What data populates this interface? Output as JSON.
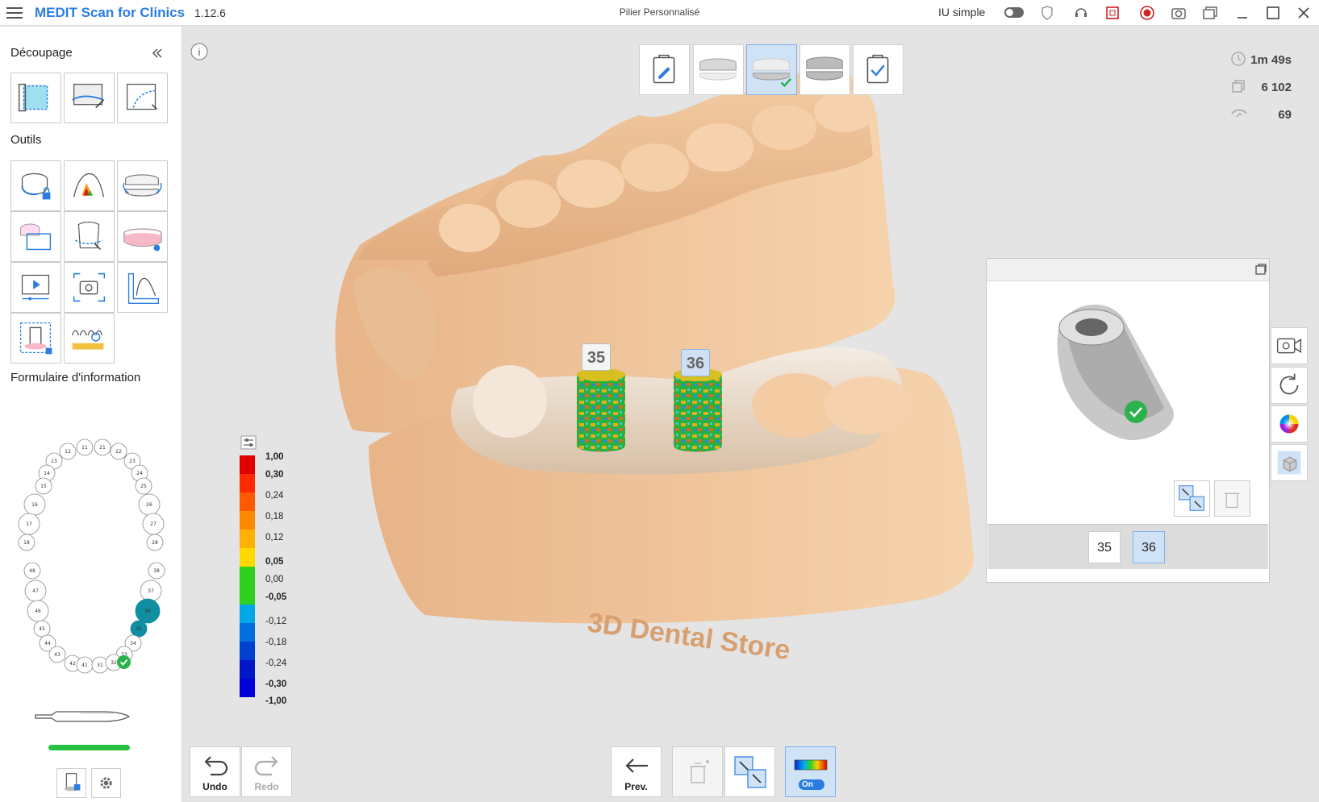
{
  "titlebar": {
    "app_name": "MEDIT Scan for Clinics",
    "version": "1.12.6",
    "document_title": "Pilier Personnalisé",
    "simple_ui_label": "IU simple",
    "icons": [
      "menu-icon",
      "shield-icon",
      "support-headset-icon",
      "screen-record-region-icon",
      "record-icon",
      "camera-icon",
      "window-switch-icon",
      "minimize-icon",
      "maximize-icon",
      "close-icon"
    ]
  },
  "sidebar": {
    "cutting_title": "Découpage",
    "tools_title": "Outils",
    "info_form_title": "Formulaire d'information",
    "collapse_icon": "double-chevron-left-icon",
    "teeth_upper": [
      "11",
      "21",
      "12",
      "22",
      "13",
      "23",
      "14",
      "24",
      "15",
      "25",
      "16",
      "26",
      "17",
      "27",
      "18",
      "28"
    ],
    "teeth_lower": [
      "48",
      "38",
      "47",
      "37",
      "46",
      "36",
      "45",
      "35",
      "44",
      "34",
      "43",
      "33",
      "42",
      "41",
      "31",
      "32"
    ],
    "selected_teeth": [
      "36",
      "35"
    ]
  },
  "canvas": {
    "info_icon": "i",
    "stats": {
      "time": "1m 49s",
      "frames": "6 102",
      "count": "69"
    },
    "labels": {
      "a": "35",
      "b": "36"
    },
    "watermark": "3D Dental Store",
    "legend": [
      "1,00",
      "0,30",
      "0,24",
      "0,18",
      "0,12",
      "0,05",
      "0,00",
      "-0,05",
      "-0,12",
      "-0,18",
      "-0,24",
      "-0,30",
      "-1,00"
    ],
    "legend_colors": [
      "#e00000",
      "#ff2a00",
      "#ff5a00",
      "#ff8a00",
      "#ffb000",
      "#ffd800",
      "#30d020",
      "#30d020",
      "#00a8e8",
      "#0070e0",
      "#0040d0",
      "#0018c8",
      "#0000d8"
    ]
  },
  "bottom": {
    "undo": "Undo",
    "redo": "Redo",
    "prev": "Prev.",
    "on": "On"
  },
  "preview": {
    "tabs": [
      "35",
      "36"
    ]
  },
  "accent": "#2b7de0",
  "teal": "#0f8f9f"
}
